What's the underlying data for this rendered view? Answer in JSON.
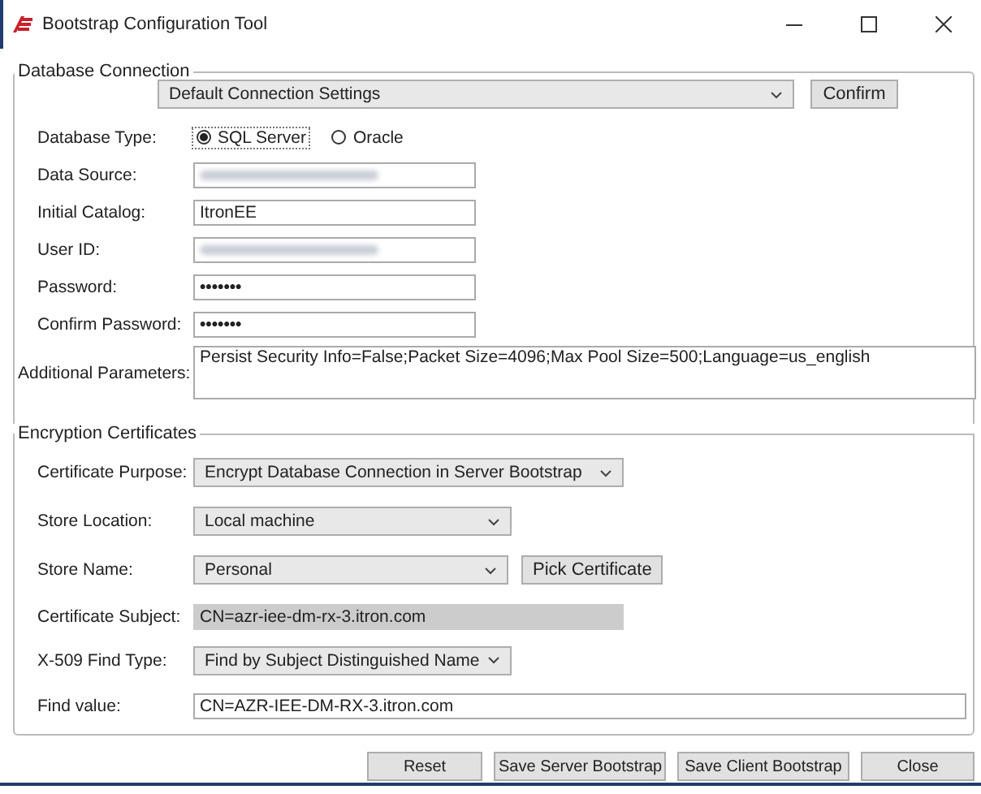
{
  "window": {
    "title": "Bootstrap Configuration Tool"
  },
  "database_connection": {
    "title": "Database Connection",
    "profile": {
      "value": "Default Connection Settings"
    },
    "confirm_button": "Confirm",
    "database_type": {
      "label": "Database Type:",
      "options": [
        {
          "label": "SQL Server",
          "selected": true
        },
        {
          "label": "Oracle",
          "selected": false
        }
      ]
    },
    "fields": [
      {
        "kind": "blurred",
        "label": "Data Source:"
      },
      {
        "kind": "text",
        "label": "Initial Catalog:",
        "value": "ItronEE"
      },
      {
        "kind": "blurred",
        "label": "User ID:"
      },
      {
        "kind": "password",
        "label": "Password:",
        "value": "•••••••"
      },
      {
        "kind": "password",
        "label": "Confirm Password:",
        "value": "•••••••"
      }
    ],
    "additional_parameters": {
      "label": "Additional Parameters:",
      "value": "Persist Security Info=False;Packet Size=4096;Max Pool Size=500;Language=us_english"
    }
  },
  "encryption_certificates": {
    "title": "Encryption Certificates",
    "rows": [
      {
        "kind": "combo",
        "label": "Certificate Purpose:",
        "value": "Encrypt Database Connection in Server Bootstrap"
      },
      {
        "kind": "combo",
        "label": "Store Location:",
        "value": "Local machine"
      },
      {
        "kind": "combo",
        "label": "Store Name:",
        "value": "Personal",
        "button": "Pick Certificate"
      },
      {
        "kind": "readonly",
        "label": "Certificate Subject:",
        "value": "CN=azr-iee-dm-rx-3.itron.com"
      },
      {
        "kind": "combo",
        "label": "X-509 Find Type:",
        "value": "Find by Subject Distinguished Name"
      },
      {
        "kind": "text",
        "label": "Find value:",
        "value": "CN=AZR-IEE-DM-RX-3.itron.com"
      }
    ]
  },
  "buttons": [
    "Reset",
    "Save Server Bootstrap",
    "Save Client Bootstrap",
    "Close"
  ]
}
